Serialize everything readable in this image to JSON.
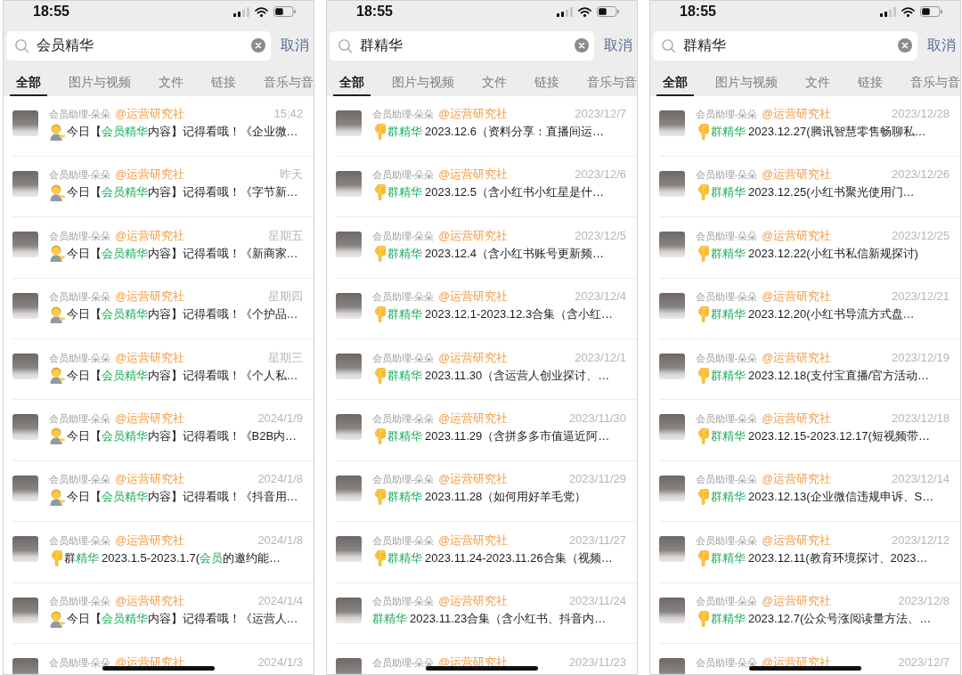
{
  "phones": [
    {
      "status_bar": {
        "time": "18:55"
      },
      "search": {
        "value": "会员精华",
        "cancel": "取消"
      },
      "tabs": [
        {
          "label": "全部",
          "selected": true
        },
        {
          "label": "图片与视频",
          "selected": false
        },
        {
          "label": "文件",
          "selected": false
        },
        {
          "label": "链接",
          "selected": false
        },
        {
          "label": "音乐与音",
          "selected": false
        }
      ],
      "results": [
        {
          "sender": "会员助理-朵朵",
          "group": "@运营研究社",
          "time": "15:42",
          "message": {
            "kind": "tipping",
            "segments": [
              {
                "text": "今日【",
                "highlight": false
              },
              {
                "text": "会员精华",
                "highlight": true
              },
              {
                "text": "内容】记得看哦！《企业微…",
                "highlight": false
              }
            ]
          }
        },
        {
          "sender": "会员助理-朵朵",
          "group": "@运营研究社",
          "time": "昨天",
          "message": {
            "kind": "tipping",
            "segments": [
              {
                "text": "今日【",
                "highlight": false
              },
              {
                "text": "会员精华",
                "highlight": true
              },
              {
                "text": "内容】记得看哦！《字节新…",
                "highlight": false
              }
            ]
          }
        },
        {
          "sender": "会员助理-朵朵",
          "group": "@运营研究社",
          "time": "星期五",
          "message": {
            "kind": "tipping",
            "segments": [
              {
                "text": "今日【",
                "highlight": false
              },
              {
                "text": "会员精华",
                "highlight": true
              },
              {
                "text": "内容】记得看哦！《新商家…",
                "highlight": false
              }
            ]
          }
        },
        {
          "sender": "会员助理-朵朵",
          "group": "@运营研究社",
          "time": "星期四",
          "message": {
            "kind": "tipping",
            "segments": [
              {
                "text": "今日【",
                "highlight": false
              },
              {
                "text": "会员精华",
                "highlight": true
              },
              {
                "text": "内容】记得看哦！《个护品…",
                "highlight": false
              }
            ]
          }
        },
        {
          "sender": "会员助理-朵朵",
          "group": "@运营研究社",
          "time": "星期三",
          "message": {
            "kind": "tipping",
            "segments": [
              {
                "text": "今日【",
                "highlight": false
              },
              {
                "text": "会员精华",
                "highlight": true
              },
              {
                "text": "内容】记得看哦！《个人私…",
                "highlight": false
              }
            ]
          }
        },
        {
          "sender": "会员助理-朵朵",
          "group": "@运营研究社",
          "time": "2024/1/9",
          "message": {
            "kind": "tipping",
            "segments": [
              {
                "text": "今日【",
                "highlight": false
              },
              {
                "text": "会员精华",
                "highlight": true
              },
              {
                "text": "内容】记得看哦！《B2B内…",
                "highlight": false
              }
            ]
          }
        },
        {
          "sender": "会员助理-朵朵",
          "group": "@运营研究社",
          "time": "2024/1/8",
          "message": {
            "kind": "tipping",
            "segments": [
              {
                "text": "今日【",
                "highlight": false
              },
              {
                "text": "会员精华",
                "highlight": true
              },
              {
                "text": "内容】记得看哦！《抖音用…",
                "highlight": false
              }
            ]
          }
        },
        {
          "sender": "会员助理-朵朵",
          "group": "@运营研究社",
          "time": "2024/1/8",
          "message": {
            "kind": "pointing",
            "segments": [
              {
                "text": "群",
                "highlight": false
              },
              {
                "text": "精华",
                "highlight": true
              },
              {
                "text": " 2023.1.5-2023.1.7(",
                "highlight": false
              },
              {
                "text": "会员",
                "highlight": true
              },
              {
                "text": "的邀约能…",
                "highlight": false
              }
            ]
          }
        },
        {
          "sender": "会员助理-朵朵",
          "group": "@运营研究社",
          "time": "2024/1/4",
          "message": {
            "kind": "tipping",
            "segments": [
              {
                "text": "今日【",
                "highlight": false
              },
              {
                "text": "会员精华",
                "highlight": true
              },
              {
                "text": "内容】记得看哦！《运营人…",
                "highlight": false
              }
            ]
          }
        },
        {
          "sender": "会员助理-朵朵",
          "group": "@运营研究社",
          "time": "2024/1/3"
        }
      ]
    },
    {
      "status_bar": {
        "time": "18:55"
      },
      "search": {
        "value": "群精华",
        "cancel": "取消"
      },
      "tabs": [
        {
          "label": "全部",
          "selected": true
        },
        {
          "label": "图片与视频",
          "selected": false
        },
        {
          "label": "文件",
          "selected": false
        },
        {
          "label": "链接",
          "selected": false
        },
        {
          "label": "音乐与音",
          "selected": false
        }
      ],
      "results": [
        {
          "sender": "会员助理-朵朵",
          "group": "@运营研究社",
          "time": "2023/12/7",
          "message": {
            "kind": "pointing",
            "segments": [
              {
                "text": "群精华",
                "highlight": true
              },
              {
                "text": " 2023.12.6（资料分享：直播间运…",
                "highlight": false
              }
            ]
          }
        },
        {
          "sender": "会员助理-朵朵",
          "group": "@运营研究社",
          "time": "2023/12/6",
          "message": {
            "kind": "pointing",
            "segments": [
              {
                "text": "群精华",
                "highlight": true
              },
              {
                "text": " 2023.12.5（含小红书小红星是什…",
                "highlight": false
              }
            ]
          }
        },
        {
          "sender": "会员助理-朵朵",
          "group": "@运营研究社",
          "time": "2023/12/5",
          "message": {
            "kind": "pointing",
            "segments": [
              {
                "text": "群精华",
                "highlight": true
              },
              {
                "text": " 2023.12.4（含小红书账号更新频…",
                "highlight": false
              }
            ]
          }
        },
        {
          "sender": "会员助理-朵朵",
          "group": "@运营研究社",
          "time": "2023/12/4",
          "message": {
            "kind": "pointing",
            "segments": [
              {
                "text": "群精华",
                "highlight": true
              },
              {
                "text": " 2023.12.1-2023.12.3合集（含小红…",
                "highlight": false
              }
            ]
          }
        },
        {
          "sender": "会员助理-朵朵",
          "group": "@运营研究社",
          "time": "2023/12/1",
          "message": {
            "kind": "pointing",
            "segments": [
              {
                "text": "群精华",
                "highlight": true
              },
              {
                "text": " 2023.11.30（含运营人创业探讨、…",
                "highlight": false
              }
            ]
          }
        },
        {
          "sender": "会员助理-朵朵",
          "group": "@运营研究社",
          "time": "2023/11/30",
          "message": {
            "kind": "pointing",
            "segments": [
              {
                "text": "群精华",
                "highlight": true
              },
              {
                "text": " 2023.11.29（含拼多多市值逼近阿…",
                "highlight": false
              }
            ]
          }
        },
        {
          "sender": "会员助理-朵朵",
          "group": "@运营研究社",
          "time": "2023/11/29",
          "message": {
            "kind": "pointing",
            "segments": [
              {
                "text": "群精华",
                "highlight": true
              },
              {
                "text": " 2023.11.28（如何用好羊毛党）",
                "highlight": false
              }
            ]
          }
        },
        {
          "sender": "会员助理-朵朵",
          "group": "@运营研究社",
          "time": "2023/11/27",
          "message": {
            "kind": "pointing",
            "segments": [
              {
                "text": "群精华",
                "highlight": true
              },
              {
                "text": " 2023.11.24-2023.11.26合集（视频…",
                "highlight": false
              }
            ]
          }
        },
        {
          "sender": "会员助理-朵朵",
          "group": "@运营研究社",
          "time": "2023/11/24",
          "message": {
            "kind": "plain",
            "segments": [
              {
                "text": "群精华",
                "highlight": true
              },
              {
                "text": " 2023.11.23合集（含小红书、抖音内…",
                "highlight": false
              }
            ]
          }
        },
        {
          "sender": "会员助理-朵朵",
          "group": "@运营研究社",
          "time": "2023/11/23"
        }
      ]
    },
    {
      "status_bar": {
        "time": "18:55"
      },
      "search": {
        "value": "群精华",
        "cancel": "取消"
      },
      "tabs": [
        {
          "label": "全部",
          "selected": true
        },
        {
          "label": "图片与视频",
          "selected": false
        },
        {
          "label": "文件",
          "selected": false
        },
        {
          "label": "链接",
          "selected": false
        },
        {
          "label": "音乐与音",
          "selected": false
        }
      ],
      "results": [
        {
          "sender": "会员助理-朵朵",
          "group": "@运营研究社",
          "time": "2023/12/28",
          "message": {
            "kind": "pointing",
            "segments": [
              {
                "text": "群精华",
                "highlight": true
              },
              {
                "text": " 2023.12.27(腾讯智慧零售畅聊私…",
                "highlight": false
              }
            ]
          }
        },
        {
          "sender": "会员助理-朵朵",
          "group": "@运营研究社",
          "time": "2023/12/26",
          "message": {
            "kind": "pointing",
            "segments": [
              {
                "text": "群精华",
                "highlight": true
              },
              {
                "text": " 2023.12.25(小红书聚光使用门…",
                "highlight": false
              }
            ]
          }
        },
        {
          "sender": "会员助理-朵朵",
          "group": "@运营研究社",
          "time": "2023/12/25",
          "message": {
            "kind": "pointing",
            "segments": [
              {
                "text": "群精华",
                "highlight": true
              },
              {
                "text": " 2023.12.22(小红书私信新规探讨)",
                "highlight": false
              }
            ]
          }
        },
        {
          "sender": "会员助理-朵朵",
          "group": "@运营研究社",
          "time": "2023/12/21",
          "message": {
            "kind": "pointing",
            "segments": [
              {
                "text": "群精华",
                "highlight": true
              },
              {
                "text": " 2023.12.20(小红书导流方式盘…",
                "highlight": false
              }
            ]
          }
        },
        {
          "sender": "会员助理-朵朵",
          "group": "@运营研究社",
          "time": "2023/12/19",
          "message": {
            "kind": "pointing",
            "segments": [
              {
                "text": "群精华",
                "highlight": true
              },
              {
                "text": " 2023.12.18(支付宝直播/官方活动…",
                "highlight": false
              }
            ]
          }
        },
        {
          "sender": "会员助理-朵朵",
          "group": "@运营研究社",
          "time": "2023/12/18",
          "message": {
            "kind": "pointing",
            "segments": [
              {
                "text": "群精华",
                "highlight": true
              },
              {
                "text": " 2023.12.15-2023.12.17(短视频带…",
                "highlight": false
              }
            ]
          }
        },
        {
          "sender": "会员助理-朵朵",
          "group": "@运营研究社",
          "time": "2023/12/14",
          "message": {
            "kind": "pointing",
            "segments": [
              {
                "text": "群精华",
                "highlight": true
              },
              {
                "text": " 2023.12.13(企业微信违规申诉、S…",
                "highlight": false
              }
            ]
          }
        },
        {
          "sender": "会员助理-朵朵",
          "group": "@运营研究社",
          "time": "2023/12/12",
          "message": {
            "kind": "pointing",
            "segments": [
              {
                "text": "群精华",
                "highlight": true
              },
              {
                "text": " 2023.12.11(教育环境探讨、2023…",
                "highlight": false
              }
            ]
          }
        },
        {
          "sender": "会员助理-朵朵",
          "group": "@运营研究社",
          "time": "2023/12/8",
          "message": {
            "kind": "pointing",
            "segments": [
              {
                "text": "群精华",
                "highlight": true
              },
              {
                "text": " 2023.12.7(公众号涨阅读量方法、…",
                "highlight": false
              }
            ]
          }
        },
        {
          "sender": "会员助理-朵朵",
          "group": "@运营研究社",
          "time": "2023/12/7"
        }
      ]
    }
  ]
}
